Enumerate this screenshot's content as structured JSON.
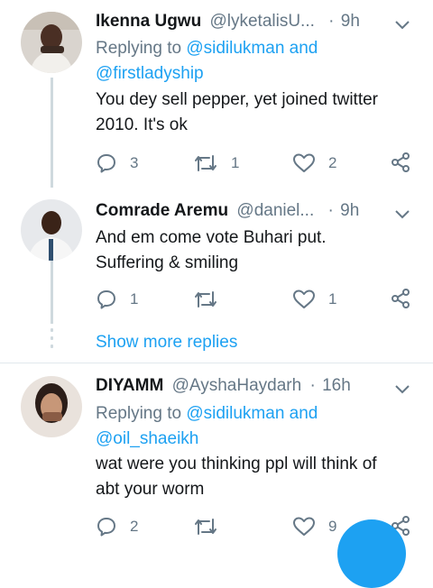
{
  "tweets": [
    {
      "name": "Ikenna Ugwu",
      "handle": "@lyketalisU...",
      "dot": "·",
      "time": "9h",
      "replying_prefix": "Replying to",
      "replying_users": [
        "@sidilukman",
        "@firstladyship"
      ],
      "replying_and": "and",
      "body": [
        "You dey sell pepper, yet joined twitter",
        "2010. It's ok"
      ],
      "replies": "3",
      "retweets": "1",
      "likes": "2"
    },
    {
      "name": "Comrade Aremu",
      "handle": "@daniel...",
      "dot": "·",
      "time": "9h",
      "body": [
        "And em come vote Buhari put.",
        "Suffering & smiling"
      ],
      "replies": "1",
      "retweets": "",
      "likes": "1"
    },
    {
      "name": "DIYAMM",
      "handle": "@AyshaHaydarh",
      "dot": "·",
      "time": "16h",
      "replying_prefix": "Replying to",
      "replying_users": [
        "@sidilukman",
        "@oil_shaeikh"
      ],
      "replying_and": "and",
      "body": [
        "wat were you thinking ppl will think of",
        "abt your worm"
      ],
      "replies": "2",
      "retweets": "",
      "likes": "9"
    }
  ],
  "show_more": "Show more replies",
  "colors": {
    "accent": "#1da1f2",
    "secondary": "#657786",
    "text": "#14171a",
    "line": "#cfd9de"
  },
  "icons": [
    "reply-icon",
    "retweet-icon",
    "like-icon",
    "share-icon",
    "chevron-down-icon"
  ]
}
